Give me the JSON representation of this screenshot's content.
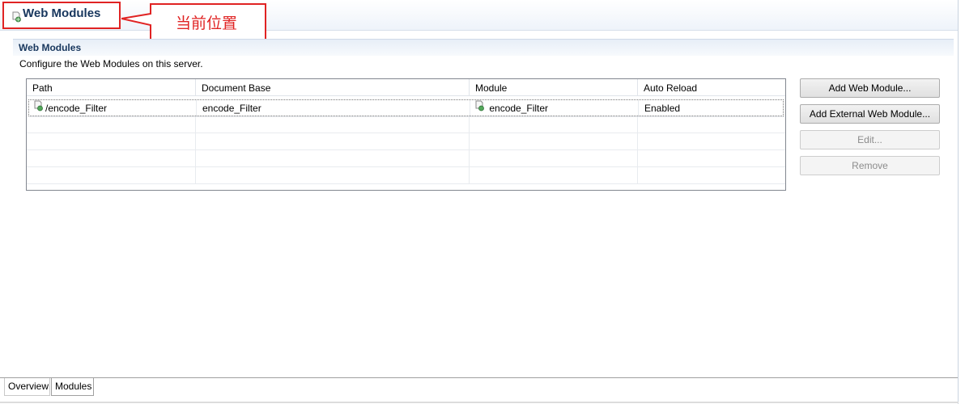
{
  "header": {
    "title": "Web Modules",
    "icon": "web-module-icon"
  },
  "annotation": {
    "label": "当前位置",
    "color": "#e02323"
  },
  "section": {
    "title": "Web Modules",
    "description": "Configure the Web Modules on this server."
  },
  "table": {
    "columns": [
      "Path",
      "Document Base",
      "Module",
      "Auto Reload"
    ],
    "rows": [
      {
        "path": "/encode_Filter",
        "document_base": "encode_Filter",
        "module": "encode_Filter",
        "auto_reload": "Enabled"
      }
    ]
  },
  "buttons": {
    "add_web_module": "Add Web Module...",
    "add_external_web_module": "Add External Web Module...",
    "edit": "Edit...",
    "remove": "Remove"
  },
  "tabs": [
    "Overview",
    "Modules"
  ],
  "colors": {
    "title": "#17365d",
    "annotation": "#e02323"
  }
}
